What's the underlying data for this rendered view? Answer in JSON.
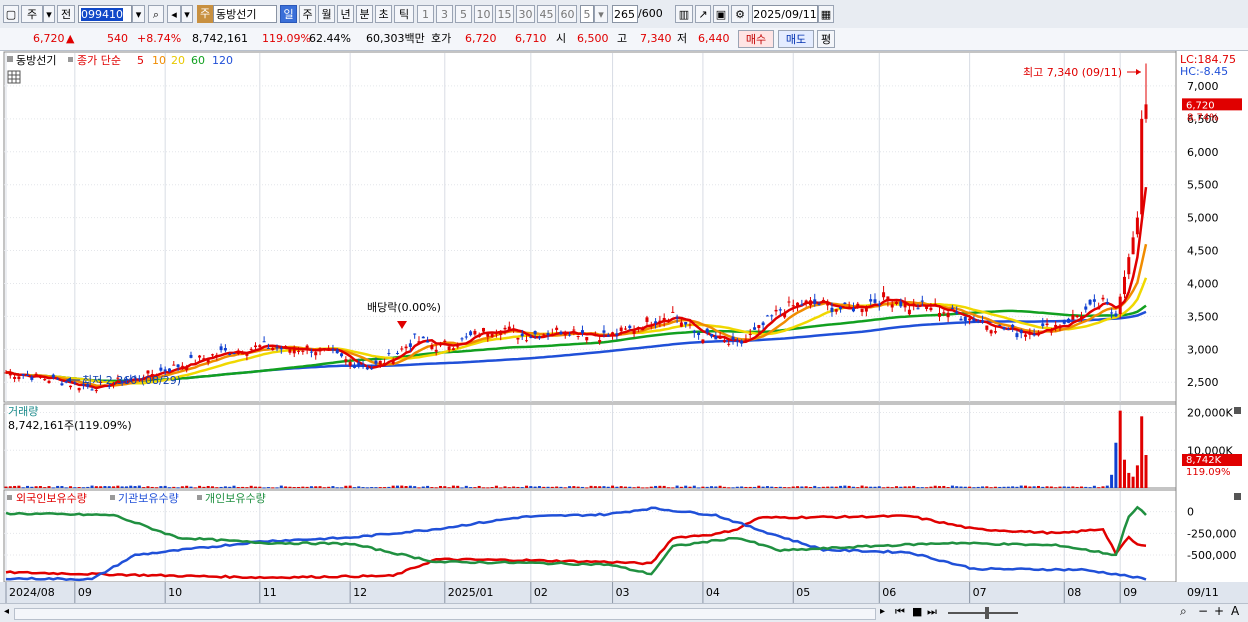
{
  "toolbar": {
    "market": "주",
    "prev_label": "전",
    "code": "099410",
    "name_badge": "주",
    "name": "동방선기",
    "periods": [
      "일",
      "주",
      "월",
      "년",
      "분",
      "초",
      "틱"
    ],
    "active_period": "일",
    "intervals": [
      "1",
      "3",
      "5",
      "10",
      "15",
      "30",
      "45",
      "60"
    ],
    "interval_value": "5",
    "count": "265",
    "count_total": "/600",
    "date": "2025/09/11"
  },
  "quote": {
    "price": "6,720",
    "change": "540",
    "change_pct": "+8.74%",
    "volume": "8,742,161",
    "volume_ratio": "119.09%",
    "turnover": "62.44%",
    "amount": "60,303백만",
    "hoga_label": "호가",
    "ask": "6,720",
    "bid": "6,710",
    "open_label": "시",
    "open": "6,500",
    "high_label": "고",
    "high": "7,340",
    "low_label": "저",
    "low": "6,440",
    "buy_btn": "매수",
    "sell_btn": "매도",
    "eval_btn": "평"
  },
  "price_panel": {
    "title": "동방선기",
    "ma_label": "종가 단순",
    "ma_periods": [
      "5",
      "10",
      "20",
      "60",
      "120"
    ],
    "ma_colors": [
      "#e00000",
      "#f08c00",
      "#f0d800",
      "#12a020",
      "#2050d8"
    ],
    "lc": "LC:184.75",
    "hc": "HC:-8.45",
    "current_price": "6,720",
    "current_pct": "8.74%",
    "high_marker": "최고 7,340 (09/11)",
    "low_marker": "최저 2,360 (08/29)",
    "dividend": "배당락(0.00%)"
  },
  "volume_panel": {
    "title": "거래량",
    "value": "8,742,161주(119.09%)",
    "current": "8,742K",
    "current_pct": "119.09%"
  },
  "holdings_panel": {
    "labels": [
      "외국인보유수량",
      "기관보유수량",
      "개인보유수량"
    ],
    "colors": [
      "#e00000",
      "#2050d8",
      "#209040"
    ]
  },
  "xaxis": {
    "labels": [
      "2024/08",
      "09",
      "10",
      "11",
      "12",
      "2025/01",
      "02",
      "03",
      "04",
      "05",
      "06",
      "07",
      "08",
      "09"
    ],
    "last": "09/11"
  },
  "chart_data": [
    {
      "type": "candlestick",
      "title": "동방선기",
      "ylim": [
        2200,
        7500
      ],
      "yticks": [
        2500,
        3000,
        3500,
        4000,
        4500,
        5000,
        5500,
        6000,
        6500,
        7000
      ],
      "ytick_labels": [
        "2,500",
        "3,000",
        "3,500",
        "4,000",
        "4,500",
        "5,000",
        "5,500",
        "6,000",
        "6,500",
        "7,000"
      ],
      "months": [
        "2024/08",
        "09",
        "10",
        "11",
        "12",
        "2025/01",
        "02",
        "03",
        "04",
        "05",
        "06",
        "07",
        "08",
        "09"
      ],
      "close_path": [
        [
          0,
          2650
        ],
        [
          5,
          2600
        ],
        [
          10,
          2550
        ],
        [
          15,
          2480
        ],
        [
          20,
          2420
        ],
        [
          25,
          2500
        ],
        [
          30,
          2560
        ],
        [
          35,
          2650
        ],
        [
          40,
          2750
        ],
        [
          45,
          2850
        ],
        [
          50,
          2950
        ],
        [
          55,
          3000
        ],
        [
          60,
          3050
        ],
        [
          65,
          3000
        ],
        [
          70,
          3020
        ],
        [
          75,
          2950
        ],
        [
          80,
          2800
        ],
        [
          85,
          2720
        ],
        [
          90,
          2900
        ],
        [
          95,
          3150
        ],
        [
          100,
          3050
        ],
        [
          105,
          3100
        ],
        [
          110,
          3250
        ],
        [
          115,
          3350
        ],
        [
          120,
          3200
        ],
        [
          125,
          3250
        ],
        [
          130,
          3300
        ],
        [
          135,
          3250
        ],
        [
          140,
          3200
        ],
        [
          145,
          3300
        ],
        [
          150,
          3450
        ],
        [
          155,
          3550
        ],
        [
          160,
          3250
        ],
        [
          165,
          3150
        ],
        [
          170,
          3050
        ],
        [
          175,
          3300
        ],
        [
          180,
          3600
        ],
        [
          185,
          3700
        ],
        [
          190,
          3680
        ],
        [
          195,
          3600
        ],
        [
          200,
          3700
        ],
        [
          205,
          3800
        ],
        [
          210,
          3650
        ],
        [
          215,
          3650
        ],
        [
          220,
          3550
        ],
        [
          225,
          3450
        ],
        [
          230,
          3350
        ],
        [
          235,
          3250
        ],
        [
          240,
          3300
        ],
        [
          245,
          3380
        ],
        [
          250,
          3550
        ],
        [
          255,
          3700
        ],
        [
          258,
          3500
        ],
        [
          261,
          4400
        ],
        [
          263,
          5000
        ],
        [
          264,
          6500
        ],
        [
          265,
          6720
        ]
      ],
      "ma_end_values": {
        "5": 5650,
        "10": 5150,
        "20": 4300,
        "60": 3700,
        "120": 3600
      },
      "high_point": {
        "label": "최고 7,340 (09/11)",
        "value": 7340
      },
      "low_point": {
        "label": "최저 2,360 (08/29)",
        "value": 2360
      }
    },
    {
      "type": "bar",
      "title": "거래량",
      "yticks": [
        10000,
        20000
      ],
      "ytick_labels": [
        "10,000K",
        "20,000K"
      ],
      "ylim": [
        0,
        22000
      ],
      "spikes": [
        [
          257,
          3500
        ],
        [
          258,
          12000
        ],
        [
          259,
          20500
        ],
        [
          260,
          7500
        ],
        [
          261,
          4000
        ],
        [
          262,
          3000
        ],
        [
          263,
          6000
        ],
        [
          264,
          19000
        ],
        [
          265,
          8742
        ]
      ]
    },
    {
      "type": "line",
      "title": "보유수량",
      "yticks": [
        0,
        -250000,
        -500000
      ],
      "ytick_labels": [
        "0",
        "-250,000",
        "-500,000"
      ],
      "ylim": [
        -800000,
        100000
      ],
      "series": [
        {
          "name": "외국인보유수량",
          "values": [
            [
              0,
              -700000
            ],
            [
              30,
              -730000
            ],
            [
              60,
              -760000
            ],
            [
              90,
              -740000
            ],
            [
              100,
              -550000
            ],
            [
              120,
              -560000
            ],
            [
              140,
              -580000
            ],
            [
              150,
              -600000
            ],
            [
              155,
              -300000
            ],
            [
              165,
              -260000
            ],
            [
              170,
              -200000
            ],
            [
              175,
              -70000
            ],
            [
              195,
              -60000
            ],
            [
              210,
              -50000
            ],
            [
              225,
              -200000
            ],
            [
              245,
              -250000
            ],
            [
              255,
              -200000
            ],
            [
              258,
              -480000
            ],
            [
              261,
              -300000
            ],
            [
              263,
              -380000
            ],
            [
              265,
              -400000
            ]
          ]
        },
        {
          "name": "기관보유수량",
          "values": [
            [
              0,
              -770000
            ],
            [
              20,
              -780000
            ],
            [
              30,
              -500000
            ],
            [
              60,
              -340000
            ],
            [
              80,
              -300000
            ],
            [
              100,
              -200000
            ],
            [
              120,
              -60000
            ],
            [
              140,
              -30000
            ],
            [
              150,
              40000
            ],
            [
              165,
              -40000
            ],
            [
              175,
              -210000
            ],
            [
              190,
              -440000
            ],
            [
              210,
              -470000
            ],
            [
              225,
              -660000
            ],
            [
              250,
              -670000
            ],
            [
              258,
              -720000
            ],
            [
              265,
              -780000
            ]
          ]
        },
        {
          "name": "개인보유수량",
          "values": [
            [
              0,
              -20000
            ],
            [
              25,
              -40000
            ],
            [
              40,
              -300000
            ],
            [
              60,
              -360000
            ],
            [
              80,
              -370000
            ],
            [
              100,
              -580000
            ],
            [
              120,
              -590000
            ],
            [
              140,
              -610000
            ],
            [
              150,
              -720000
            ],
            [
              155,
              -400000
            ],
            [
              170,
              -300000
            ],
            [
              180,
              -450000
            ],
            [
              200,
              -400000
            ],
            [
              220,
              -360000
            ],
            [
              245,
              -390000
            ],
            [
              258,
              -500000
            ],
            [
              261,
              -50000
            ],
            [
              263,
              50000
            ],
            [
              265,
              -40000
            ]
          ]
        }
      ]
    }
  ]
}
